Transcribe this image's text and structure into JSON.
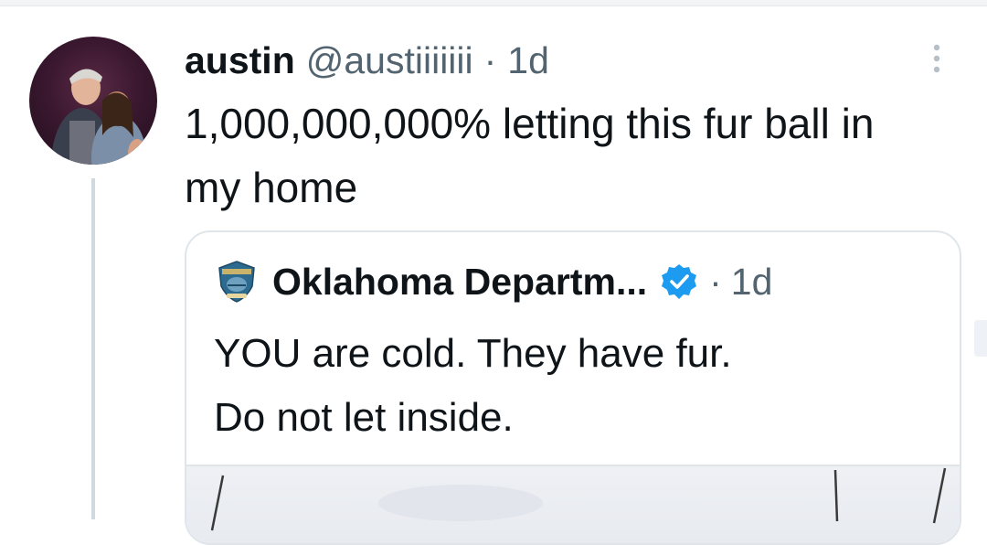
{
  "tweet": {
    "author_name": "austin",
    "author_handle": "@austiiiiiii",
    "separator": "·",
    "time": "1d",
    "text": "1,000,000,000% letting this fur ball in my home"
  },
  "quoted_tweet": {
    "author_name": "Oklahoma Departm...",
    "separator": "·",
    "time": "1d",
    "text_line1": "YOU are cold. They have fur.",
    "text_line2": "Do not let inside."
  },
  "icons": {
    "avatar": "profile-photo-two-people",
    "more": "more-vertical-icon",
    "quote_avatar": "oklahoma-seal-icon",
    "verified": "verified-badge-icon"
  },
  "colors": {
    "text_primary": "#0f1419",
    "text_secondary": "#536471",
    "verified_blue": "#1d9bf0",
    "border": "#dfe5e9"
  }
}
